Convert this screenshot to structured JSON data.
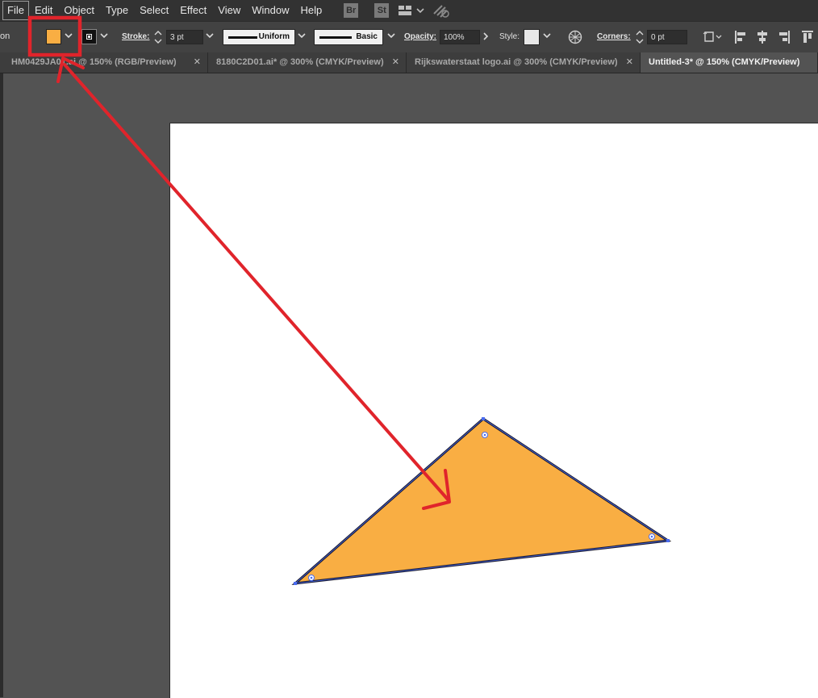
{
  "menu": {
    "items": [
      "File",
      "Edit",
      "Object",
      "Type",
      "Select",
      "Effect",
      "View",
      "Window",
      "Help"
    ],
    "app_buttons": [
      "Br",
      "St"
    ]
  },
  "control": {
    "panel_label": "on",
    "fill_color": "#f9ae43",
    "stroke_label": "Stroke:",
    "stroke_weight": "3 pt",
    "profile_label": "Uniform",
    "brush_label": "Basic",
    "opacity_label": "Opacity:",
    "opacity_value": "100%",
    "style_label": "Style:",
    "corners_label": "Corners:",
    "corners_value": "0 pt"
  },
  "tabs": [
    {
      "label": "HM0429JA01.ai @ 150% (RGB/Preview)",
      "active": false
    },
    {
      "label": "8180C2D01.ai* @ 300% (CMYK/Preview)",
      "active": false
    },
    {
      "label": "Rijkswaterstaat logo.ai @ 300% (CMYK/Preview)",
      "active": false
    },
    {
      "label": "Untitled-3* @ 150% (CMYK/Preview)",
      "active": true
    }
  ],
  "colors": {
    "triangle_fill": "#f9ae43",
    "triangle_stroke": "#1a1a2e",
    "annotation": "#e0242b",
    "anchor": "#4a6cf0"
  },
  "icons": [
    "chevron-down-icon",
    "globe-icon",
    "align-left-icon",
    "align-center-icon",
    "align-right-icon",
    "align-top-icon"
  ]
}
